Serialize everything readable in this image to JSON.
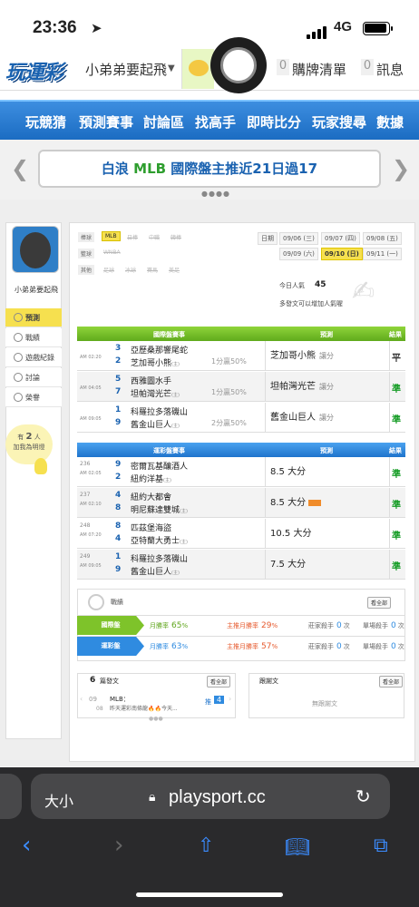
{
  "status": {
    "time": "23:36",
    "network": "4G"
  },
  "header": {
    "logo": "玩運彩",
    "user": "小弟弟要起飛",
    "cart_count": "0",
    "cart_label": "購牌清單",
    "msg_count": "0",
    "msg_label": "訊息"
  },
  "nav": [
    "玩競猜",
    "預測賽事",
    "討論區",
    "找高手",
    "即時比分",
    "玩家搜尋",
    "數據"
  ],
  "banner": {
    "pre": "白浪 ",
    "league": "MLB",
    "post": " 國際盤主推近21日過17"
  },
  "sidebar": {
    "username": "小弟弟要起飛",
    "items": [
      "預測",
      "戰績",
      "遊戲紀錄",
      "討論",
      "榮譽"
    ],
    "fans_pre": "有",
    "fans_count": "2",
    "fans_unit": "人",
    "fans_post": "加我為明燈"
  },
  "sports": {
    "baseball": "棒球",
    "basketball": "籃球",
    "other": "其他",
    "mlb": "MLB",
    "b1": "日棒",
    "b2": "中職",
    "b3": "韓棒",
    "k1": "WNBA",
    "o1": "足球",
    "o2": "冰球",
    "o3": "賽馬",
    "o4": "美足"
  },
  "dates": {
    "label": "日期",
    "d": [
      "09/06 (三)",
      "09/07 (四)",
      "09/08 (五)",
      "09/09 (六)",
      "09/10 (日)",
      "09/11 (一)"
    ]
  },
  "popularity": {
    "label": "今日人氣",
    "count": "45",
    "note": "多發文可以增加人氣喔"
  },
  "intl": {
    "h1": "國際盤賽事",
    "h2": "預測",
    "h3": "結果",
    "rows": [
      {
        "time": "AM 02:20",
        "n1": "3",
        "t1": "亞歷桑那響尾蛇",
        "n2": "2",
        "t2": "芝加哥小熊",
        "m": "(主)",
        "odds": "1分贏50%",
        "pick": "芝加哥小熊",
        "type": "讓分",
        "res": "平"
      },
      {
        "time": "AM 04:05",
        "n1": "5",
        "t1": "西雅圖水手",
        "n2": "7",
        "t2": "坦帕灣光芒",
        "m": "(主)",
        "odds": "1分贏50%",
        "pick": "坦帕灣光芒",
        "type": "讓分",
        "res": "準"
      },
      {
        "time": "AM 09:05",
        "n1": "1",
        "t1": "科羅拉多落磯山",
        "n2": "9",
        "t2": "舊金山巨人",
        "m": "(主)",
        "odds": "2分贏50%",
        "pick": "舊金山巨人",
        "type": "讓分",
        "res": "準"
      }
    ]
  },
  "lottery": {
    "h1": "運彩盤賽事",
    "h2": "預測",
    "h3": "結果",
    "rows": [
      {
        "num": "236",
        "time": "AM 02:05",
        "n1": "9",
        "t1": "密爾瓦基釀酒人",
        "n2": "2",
        "t2": "紐約洋基",
        "m": "(主)",
        "pick": "8.5 大分",
        "hot": false,
        "res": "準"
      },
      {
        "num": "237",
        "time": "AM 02:10",
        "n1": "4",
        "t1": "紐約大都會",
        "n2": "8",
        "t2": "明尼蘇達雙城",
        "m": "(主)",
        "pick": "8.5 大分",
        "hot": true,
        "res": "準"
      },
      {
        "num": "248",
        "time": "AM 07:20",
        "n1": "8",
        "t1": "匹茲堡海盜",
        "n2": "4",
        "t2": "亞特蘭大勇士",
        "m": "(主)",
        "pick": "10.5 大分",
        "hot": false,
        "res": "準"
      },
      {
        "num": "249",
        "time": "AM 09:05",
        "n1": "1",
        "t1": "科羅拉多落磯山",
        "n2": "9",
        "t2": "舊金山巨人",
        "m": "(主)",
        "pick": "7.5 大分",
        "hot": false,
        "res": "準"
      }
    ]
  },
  "stats": {
    "title": "戰績",
    "all": "看全部",
    "rows": [
      {
        "label": "國際盤",
        "win_label": "月勝率",
        "win": "65",
        "main_label": "主推月勝率",
        "main": "29",
        "kill_label": "莊家殺手",
        "kill": "0",
        "single_label": "單場殺手",
        "single": "0",
        "unit": "次"
      },
      {
        "label": "運彩盤",
        "win_label": "月勝率",
        "win": "63",
        "main_label": "主推月勝率",
        "main": "57",
        "kill_label": "莊家殺手",
        "kill": "0",
        "single_label": "單場殺手",
        "single": "0",
        "unit": "次"
      }
    ]
  },
  "posts": {
    "count": "6",
    "title": "篇發文",
    "all": "看全部",
    "day": "09",
    "date": "08",
    "league": "MLB：",
    "snippet": "昨天運彩南條龍🔥🔥今天...",
    "pushlabel": "推",
    "push": "4"
  },
  "replies": {
    "title": "跟謝文",
    "all": "看全部",
    "empty": "無跟謝文"
  },
  "safari": {
    "aa": "大小",
    "url": "playsport.cc"
  },
  "colors": {
    "green": "#7ec32a",
    "blue": "#2f8be0",
    "yellow": "#f6e04f"
  }
}
